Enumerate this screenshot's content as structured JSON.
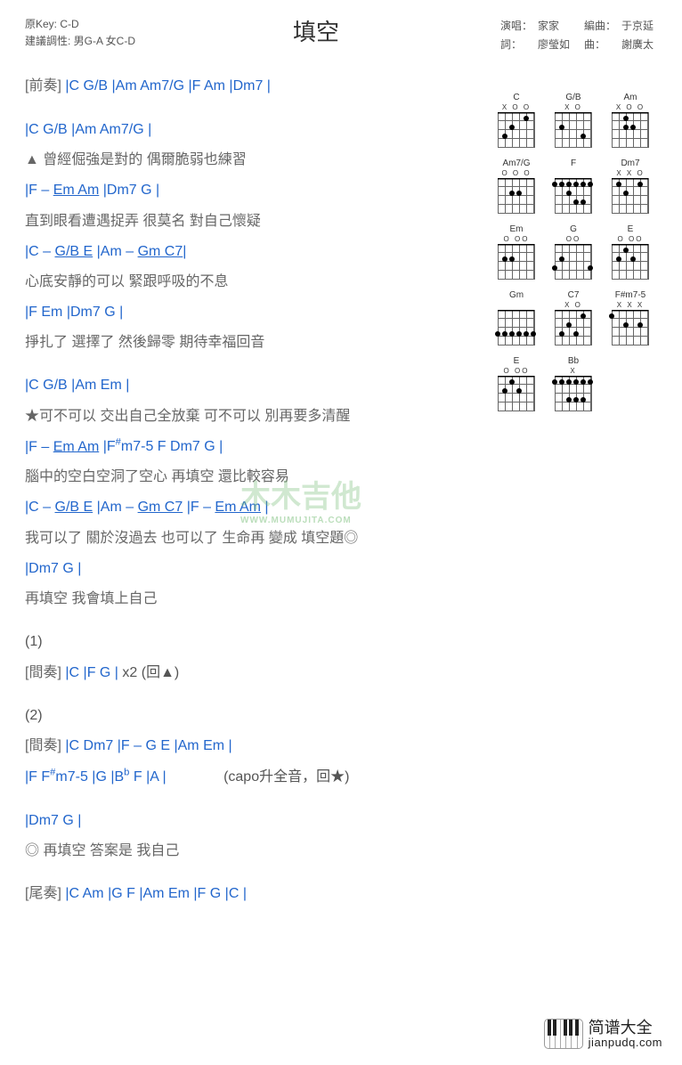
{
  "header": {
    "title": "填空",
    "left_meta_key": "原Key: C-D",
    "left_meta_suggest": "建議調性: 男G-A 女C-D",
    "credits": {
      "singer_label": "演唱：",
      "singer": "家家",
      "arranger_label": "編曲：",
      "arranger": "于京延",
      "lyricist_label": "詞：",
      "lyricist": "廖瑩如",
      "composer_label": "曲：",
      "composer": "謝廣太"
    }
  },
  "diagram_chords": [
    "C",
    "G/B",
    "Am",
    "Am7/G",
    "F",
    "Dm7",
    "Em",
    "G",
    "E",
    "Gm",
    "C7",
    "F#m7-5",
    "E",
    "Bb"
  ],
  "sections": {
    "intro_tag": "[前奏]",
    "intro_chords": " |C  G/B  |Am  Am7/G  |F  Am  |Dm7     |",
    "v1": [
      {
        "chords": "|C      G/B         |Am     Am7/G    |",
        "lyrics": "▲ 曾經倔強是對的    偶爾脆弱也練習"
      },
      {
        "chords": "|F   –    Em  Am    |Dm7         G            |",
        "lyrics": " 直到眼看遭遇捉弄   很莫名   對自己懷疑",
        "ul": "Em  Am"
      },
      {
        "chords": "|C  –  G/B  E     |Am     –    Gm C7|",
        "lyrics": "   心底安靜的可以    緊跟呼吸的不息",
        "ul1": "G/B  E",
        "ul2": "Gm C7"
      },
      {
        "chords": "|F                Em       |Dm7       G |",
        "lyrics": " 掙扎了  選擇了  然後歸零   期待幸福回音"
      }
    ],
    "chorus": [
      {
        "chords": "    |C                G/B         |Am            Em         |",
        "lyrics": " ★可不可以 交出自己全放棄 可不可以 別再要多清醒"
      },
      {
        "chords": " |F       –       Em  Am     |F#m7-5  F  Dm7  G |",
        "lyrics": " 腦中的空白空洞了空心   再填空     還比較容易",
        "ul": "Em  Am"
      },
      {
        "chords": " |C     –      G/B  E     |Am    –     Gm    C7    |F  –  Em Am |",
        "lyrics": "   我可以了 關於沒過去  也可以了 生命再 變成     填空題◎",
        "ul1": "G/B  E",
        "ul2": "Gm    C7",
        "ul3": "Em Am"
      },
      {
        "chords": " |Dm7       G    |",
        "lyrics": "  再填空  我會填上自己"
      }
    ],
    "inter1_num": "(1)",
    "inter1_tag": "[間奏]",
    "inter1_chords": " |C    |F  G  | x2  (回▲)",
    "inter2_num": "(2)",
    "inter2_tag": "[間奏]",
    "inter2_chords1": " |C  Dm7  |F  –   G  E    |Am  Em  |",
    "inter2_chords2": "            |F  F#m7-5   |G    |Bb  F  |A    |",
    "inter2_note": "(capo升全音，回★)",
    "coda_chords": "  |Dm7       G       |",
    "coda_lyrics": "◎ 再填空 答案是 我自己",
    "outro_tag": "[尾奏]",
    "outro_chords": " |C  Am  |G  F   |Am  Em  |F  G  |C      |"
  },
  "logo": {
    "text_big": "简谱大全",
    "text_url": "jianpudq.com"
  },
  "watermark": "木木吉他"
}
